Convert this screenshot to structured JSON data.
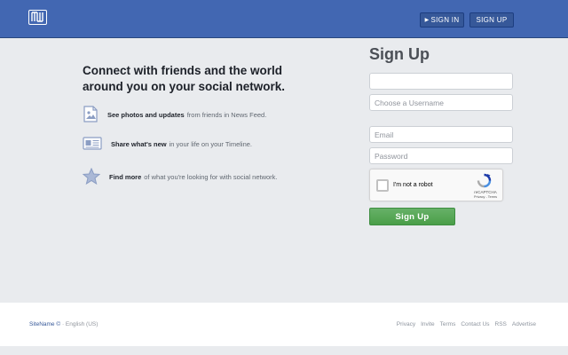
{
  "header": {
    "signin_label": "SIGN IN",
    "signup_label": "SIGN UP",
    "signin_icon": "sign-in-icon"
  },
  "left": {
    "headline": "Connect with friends and the world around you on your social network.",
    "features": [
      {
        "icon": "photo-icon",
        "bold": "See photos and updates",
        "text": "from friends in News Feed."
      },
      {
        "icon": "timeline-icon",
        "bold": "Share what's new",
        "text": "in your life on your Timeline."
      },
      {
        "icon": "star-icon",
        "bold": "Find more",
        "text": "of what you're looking for with social network."
      }
    ]
  },
  "form": {
    "title": "Sign Up",
    "field1_placeholder": "",
    "username_placeholder": "Choose a Username",
    "email_placeholder": "Email",
    "password_placeholder": "Password",
    "captcha_label": "I'm not a robot",
    "captcha_brand": "reCAPTCHA",
    "captcha_terms": "Privacy - Terms",
    "submit_label": "Sign Up"
  },
  "footer": {
    "site_name": "SiteName ©",
    "language": "· English (US)",
    "links": [
      "Privacy",
      "Invite",
      "Terms",
      "Contact Us",
      "RSS",
      "Advertise"
    ]
  },
  "colors": {
    "header_bg": "#4267b2",
    "button_green": "#4a9e48",
    "page_bg": "#e9ebee"
  }
}
